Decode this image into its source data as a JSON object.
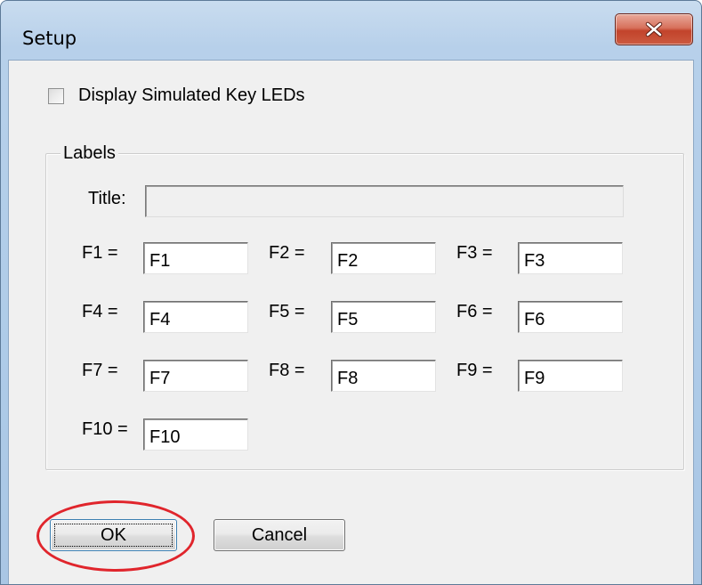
{
  "window": {
    "title": "Setup",
    "close_icon": "close-x-icon"
  },
  "options": {
    "display_leds_label": "Display Simulated Key LEDs",
    "display_leds_checked": false
  },
  "labels_group": {
    "legend": "Labels",
    "title_label": "Title:",
    "title_value": "",
    "fkeys": [
      {
        "label": "F1 =",
        "value": "F1"
      },
      {
        "label": "F2 =",
        "value": "F2"
      },
      {
        "label": "F3 =",
        "value": "F3"
      },
      {
        "label": "F4 =",
        "value": "F4"
      },
      {
        "label": "F5 =",
        "value": "F5"
      },
      {
        "label": "F6 =",
        "value": "F6"
      },
      {
        "label": "F7 =",
        "value": "F7"
      },
      {
        "label": "F8 =",
        "value": "F8"
      },
      {
        "label": "F9 =",
        "value": "F9"
      },
      {
        "label": "F10 =",
        "value": "F10"
      }
    ]
  },
  "buttons": {
    "ok_label": "OK",
    "cancel_label": "Cancel"
  },
  "colors": {
    "annotation": "#e0252c",
    "close_button": "#c2432b"
  }
}
